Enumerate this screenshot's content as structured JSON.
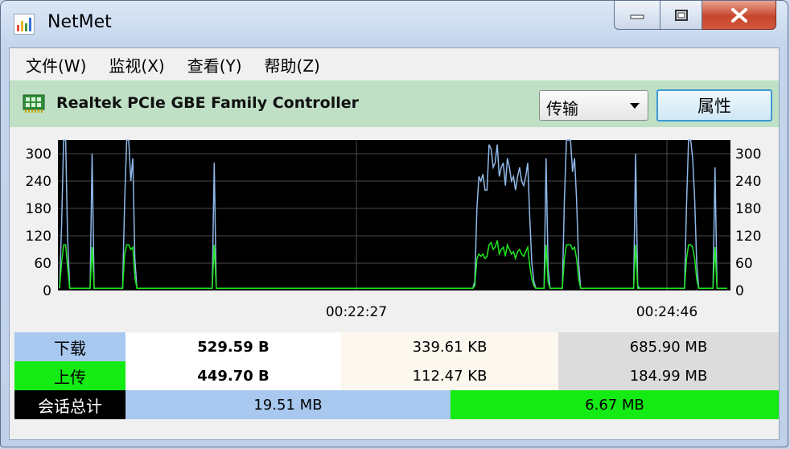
{
  "window": {
    "title": "NetMet"
  },
  "menu": [
    {
      "label": "文件(W)"
    },
    {
      "label": "监视(X)"
    },
    {
      "label": "查看(Y)"
    },
    {
      "label": "帮助(Z)"
    }
  ],
  "device": {
    "name": "Realtek PCIe GBE Family Controller",
    "mode": "传输",
    "properties_label": "属性"
  },
  "chart_data": {
    "type": "line",
    "y_ticks": [
      "300",
      "240",
      "180",
      "120",
      "60",
      "0"
    ],
    "ylim": [
      0,
      330
    ],
    "x_ticks": [
      "00:22:27",
      "00:24:46"
    ],
    "grid": true,
    "series": [
      {
        "color": "#8fb8e8",
        "values": [
          5,
          140,
          330,
          330,
          110,
          5,
          5,
          5,
          5,
          5,
          5,
          5,
          5,
          5,
          5,
          5,
          300,
          5,
          5,
          5,
          5,
          5,
          5,
          5,
          5,
          5,
          5,
          5,
          5,
          5,
          5,
          5,
          200,
          330,
          330,
          240,
          290,
          70,
          5,
          5,
          5,
          5,
          5,
          5,
          5,
          5,
          5,
          5,
          5,
          5,
          5,
          5,
          5,
          5,
          5,
          5,
          5,
          5,
          5,
          5,
          5,
          5,
          5,
          5,
          5,
          5,
          5,
          5,
          5,
          5,
          5,
          5,
          5,
          5,
          5,
          5,
          280,
          5,
          5,
          5,
          5,
          5,
          5,
          5,
          5,
          5,
          5,
          5,
          5,
          5,
          5,
          5,
          5,
          5,
          5,
          5,
          5,
          5,
          5,
          5,
          5,
          5,
          5,
          5,
          5,
          5,
          5,
          5,
          5,
          5,
          5,
          5,
          5,
          5,
          5,
          5,
          5,
          5,
          5,
          5,
          5,
          5,
          5,
          5,
          5,
          5,
          5,
          5,
          5,
          5,
          5,
          5,
          5,
          5,
          5,
          5,
          5,
          5,
          5,
          5,
          5,
          5,
          5,
          5,
          5,
          5,
          5,
          5,
          5,
          5,
          5,
          5,
          5,
          5,
          5,
          5,
          5,
          5,
          5,
          5,
          5,
          5,
          5,
          5,
          5,
          5,
          5,
          5,
          5,
          5,
          5,
          5,
          5,
          5,
          5,
          5,
          5,
          5,
          5,
          5,
          5,
          5,
          5,
          5,
          5,
          5,
          5,
          5,
          5,
          5,
          5,
          5,
          5,
          5,
          5,
          5,
          5,
          5,
          5,
          5,
          5,
          5,
          5,
          5,
          20,
          180,
          250,
          240,
          255,
          220,
          220,
          320,
          310,
          270,
          280,
          320,
          250,
          270,
          280,
          230,
          290,
          270,
          240,
          250,
          220,
          250,
          270,
          240,
          230,
          250,
          280,
          160,
          60,
          20,
          5,
          5,
          5,
          5,
          5,
          290,
          50,
          5,
          5,
          5,
          5,
          5,
          5,
          5,
          200,
          330,
          330,
          330,
          260,
          290,
          200,
          60,
          5,
          5,
          5,
          5,
          5,
          5,
          5,
          5,
          5,
          5,
          5,
          5,
          5,
          5,
          5,
          5,
          5,
          5,
          5,
          5,
          5,
          5,
          5,
          5,
          5,
          5,
          5,
          300,
          10,
          5,
          5,
          5,
          5,
          5,
          5,
          5,
          5,
          5,
          5,
          5,
          5,
          5,
          5,
          5,
          5,
          5,
          5,
          5,
          5,
          5,
          5,
          5,
          190,
          330,
          330,
          290,
          200,
          60,
          5,
          5,
          5,
          5,
          5,
          5,
          5,
          5,
          270,
          5,
          5,
          5,
          5,
          5,
          5
        ]
      },
      {
        "color": "#1ee81e",
        "values": [
          5,
          60,
          100,
          100,
          50,
          5,
          5,
          5,
          5,
          5,
          5,
          5,
          5,
          5,
          5,
          5,
          95,
          5,
          5,
          5,
          5,
          5,
          5,
          5,
          5,
          5,
          5,
          5,
          5,
          5,
          5,
          5,
          80,
          100,
          100,
          90,
          95,
          30,
          5,
          5,
          5,
          5,
          5,
          5,
          5,
          5,
          5,
          5,
          5,
          5,
          5,
          5,
          5,
          5,
          5,
          5,
          5,
          5,
          5,
          5,
          5,
          5,
          5,
          5,
          5,
          5,
          5,
          5,
          5,
          5,
          5,
          5,
          5,
          5,
          5,
          5,
          100,
          5,
          5,
          5,
          5,
          5,
          5,
          5,
          5,
          5,
          5,
          5,
          5,
          5,
          5,
          5,
          5,
          5,
          5,
          5,
          5,
          5,
          5,
          5,
          5,
          5,
          5,
          5,
          5,
          5,
          5,
          5,
          5,
          5,
          5,
          5,
          5,
          5,
          5,
          5,
          5,
          5,
          5,
          5,
          5,
          5,
          5,
          5,
          5,
          5,
          5,
          5,
          5,
          5,
          5,
          5,
          5,
          5,
          5,
          5,
          5,
          5,
          5,
          5,
          5,
          5,
          5,
          5,
          5,
          5,
          5,
          5,
          5,
          5,
          5,
          5,
          5,
          5,
          5,
          5,
          5,
          5,
          5,
          5,
          5,
          5,
          5,
          5,
          5,
          5,
          5,
          5,
          5,
          5,
          5,
          5,
          5,
          5,
          5,
          5,
          5,
          5,
          5,
          5,
          5,
          5,
          5,
          5,
          5,
          5,
          5,
          5,
          5,
          5,
          5,
          5,
          5,
          5,
          5,
          5,
          5,
          5,
          5,
          5,
          5,
          5,
          5,
          5,
          10,
          70,
          80,
          75,
          80,
          70,
          75,
          100,
          105,
          90,
          95,
          110,
          80,
          90,
          95,
          75,
          100,
          90,
          80,
          85,
          70,
          85,
          90,
          80,
          75,
          85,
          95,
          55,
          25,
          10,
          5,
          5,
          5,
          5,
          5,
          100,
          20,
          5,
          5,
          5,
          5,
          5,
          5,
          5,
          70,
          100,
          100,
          100,
          90,
          95,
          70,
          25,
          5,
          5,
          5,
          5,
          5,
          5,
          5,
          5,
          5,
          5,
          5,
          5,
          5,
          5,
          5,
          5,
          5,
          5,
          5,
          5,
          5,
          5,
          5,
          5,
          5,
          5,
          5,
          100,
          5,
          5,
          5,
          5,
          5,
          5,
          5,
          5,
          5,
          5,
          5,
          5,
          5,
          5,
          5,
          5,
          5,
          5,
          5,
          5,
          5,
          5,
          5,
          5,
          70,
          100,
          100,
          95,
          70,
          25,
          5,
          5,
          5,
          5,
          5,
          5,
          5,
          5,
          95,
          5,
          5,
          5,
          5,
          5,
          5
        ]
      }
    ]
  },
  "stats": {
    "download": {
      "label": "下载",
      "current": "529.59 B",
      "peak": "339.61 KB",
      "total": "685.90 MB",
      "color": "#a8c8ef"
    },
    "upload": {
      "label": "上传",
      "current": "449.70 B",
      "peak": "112.47 KB",
      "total": "184.99 MB",
      "color": "#14ea14"
    },
    "session": {
      "label": "会话总计",
      "download": "19.51 MB",
      "upload": "6.67 MB"
    }
  }
}
